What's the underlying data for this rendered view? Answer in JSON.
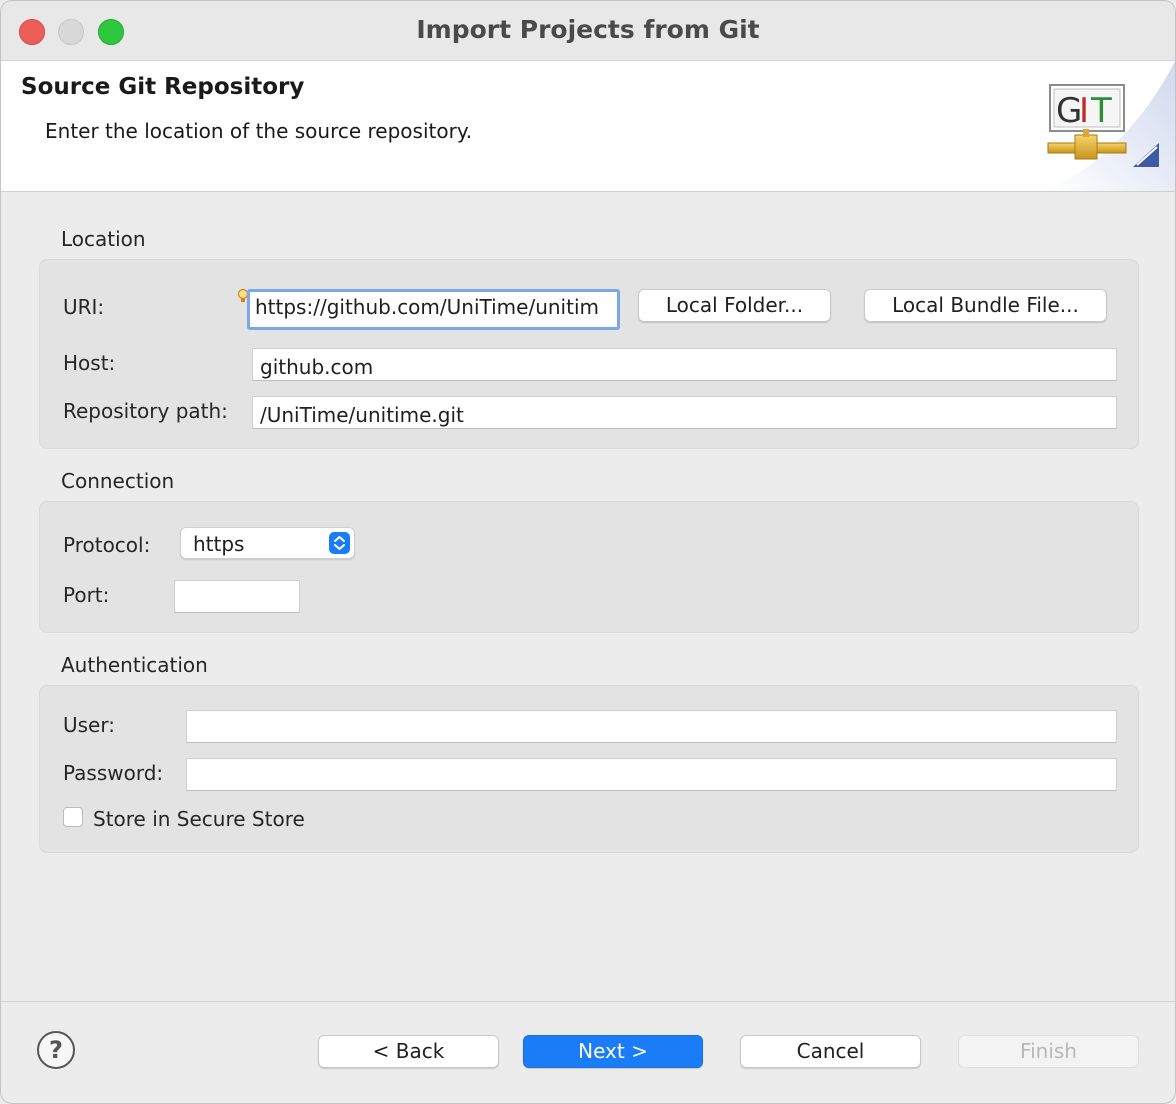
{
  "window": {
    "title": "Import Projects from Git"
  },
  "banner": {
    "title": "Source Git Repository",
    "description": "Enter the location of the source repository.",
    "logo_text": "GIT",
    "logo_icon": "git-wizard-icon"
  },
  "location": {
    "section_label": "Location",
    "uri_label": "URI:",
    "uri_value": "https://github.com/UniTime/unitim",
    "local_folder_button": "Local Folder...",
    "local_bundle_button": "Local Bundle File...",
    "host_label": "Host:",
    "host_value": "github.com",
    "repo_path_label": "Repository path:",
    "repo_path_value": "/UniTime/unitime.git"
  },
  "connection": {
    "section_label": "Connection",
    "protocol_label": "Protocol:",
    "protocol_value": "https",
    "port_label": "Port:",
    "port_value": ""
  },
  "authentication": {
    "section_label": "Authentication",
    "user_label": "User:",
    "user_value": "",
    "password_label": "Password:",
    "password_value": "",
    "store_label": "Store in Secure Store",
    "store_checked": false
  },
  "footer": {
    "help_glyph": "?",
    "back_button": "< Back",
    "next_button": "Next >",
    "cancel_button": "Cancel",
    "finish_button": "Finish"
  },
  "colors": {
    "accent": "#1a7cf7",
    "close": "#ec5f57",
    "zoom": "#2dc840",
    "focus_ring": "#7aa7e8"
  }
}
